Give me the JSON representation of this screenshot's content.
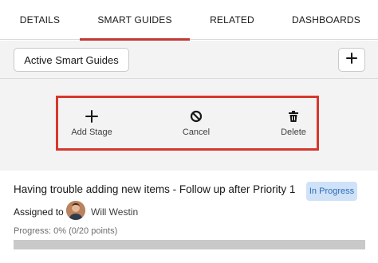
{
  "tabs": [
    {
      "label": "DETAILS",
      "active": false
    },
    {
      "label": "SMART GUIDES",
      "active": true
    },
    {
      "label": "RELATED",
      "active": false
    },
    {
      "label": "DASHBOARDS",
      "active": false
    }
  ],
  "accent_color": "#c23934",
  "header": {
    "active_guides_label": "Active Smart Guides",
    "add_icon": "plus-icon"
  },
  "toolbar": {
    "highlight_color": "#d6382d",
    "actions": [
      {
        "label": "Add Stage",
        "icon": "plus-icon"
      },
      {
        "label": "Cancel",
        "icon": "ban-icon"
      },
      {
        "label": "Delete",
        "icon": "trash-icon"
      }
    ]
  },
  "guide": {
    "title": "Having trouble adding new items - Follow up after Priority 1",
    "status": "In Progress",
    "status_bg": "#cfe2f8",
    "status_color": "#2e6db5",
    "assigned_label": "Assigned to",
    "assignee": "Will Westin",
    "progress_text": "Progress: 0% (0/20 points)",
    "progress_fraction": 0
  }
}
